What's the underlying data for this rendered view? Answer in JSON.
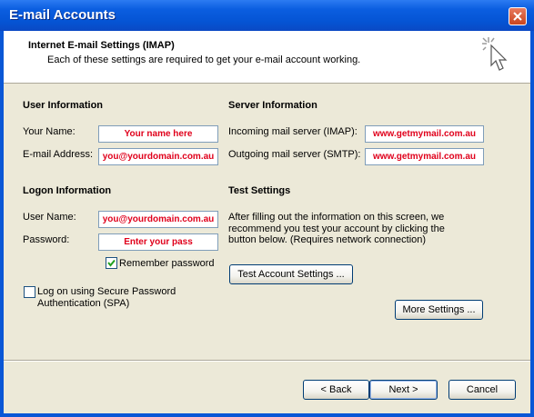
{
  "window": {
    "title": "E-mail Accounts",
    "close_label": ""
  },
  "header": {
    "title": "Internet E-mail Settings (IMAP)",
    "subtitle": "Each of these settings are required to get your e-mail account working."
  },
  "user_info": {
    "heading": "User Information",
    "name_label": "Your Name:",
    "name_value": "Your name here",
    "email_label": "E-mail Address:",
    "email_value": "you@yourdomain.com.au"
  },
  "server_info": {
    "heading": "Server Information",
    "incoming_label": "Incoming mail server (IMAP):",
    "incoming_value": "www.getmymail.com.au",
    "outgoing_label": "Outgoing mail server (SMTP):",
    "outgoing_value": "www.getmymail.com.au"
  },
  "logon_info": {
    "heading": "Logon Information",
    "user_label": "User Name:",
    "user_value": "you@yourdomain.com.au",
    "password_label": "Password:",
    "password_value": "Enter your pass",
    "remember_label": "Remember password",
    "remember_checked": true,
    "spa_label_line1": "Log on using Secure Password",
    "spa_label_line2": "Authentication (SPA)",
    "spa_checked": false
  },
  "test_settings": {
    "heading": "Test Settings",
    "description_line1": "After filling out the information on this screen, we",
    "description_line2": "recommend you test your account by clicking the",
    "description_line3": "button below. (Requires network connection)",
    "test_button": "Test Account Settings ..."
  },
  "more_settings_button": "More Settings ...",
  "footer": {
    "back_button": "< Back",
    "next_button": "Next >",
    "cancel_button": "Cancel"
  },
  "colors": {
    "titlebar": "#0554d4",
    "field_text": "#e0001b",
    "dialog_bg": "#ece9d8",
    "check_green": "#21a121"
  }
}
